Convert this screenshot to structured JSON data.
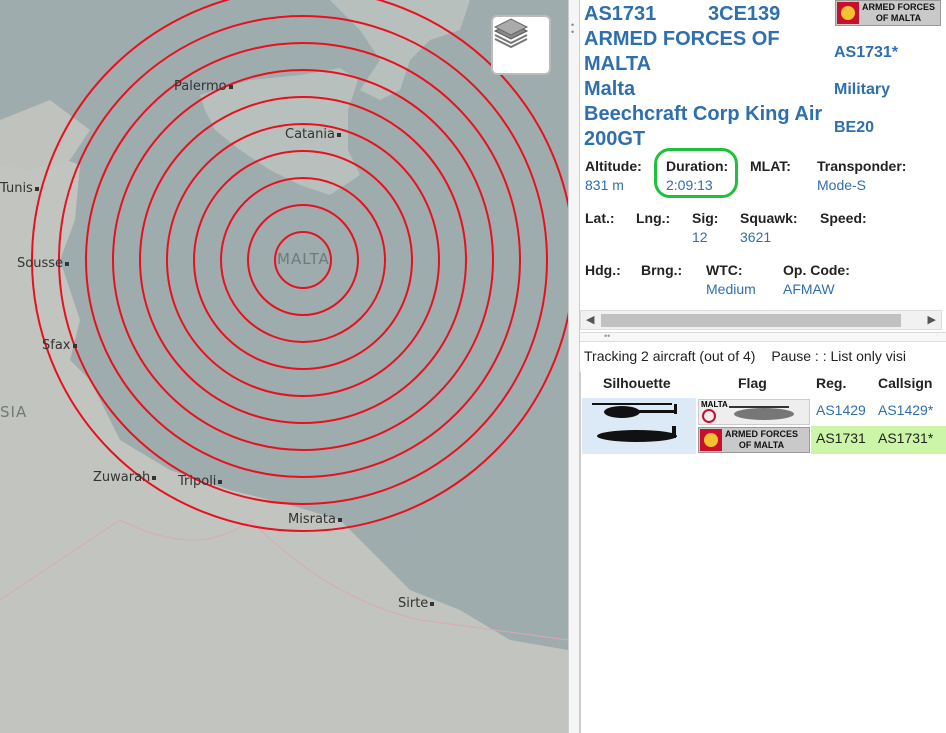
{
  "map": {
    "cities": [
      {
        "name": "Palermo"
      },
      {
        "name": "Catania"
      },
      {
        "name": "Tunis"
      },
      {
        "name": "Sousse"
      },
      {
        "name": "Sfax"
      },
      {
        "name": "Zuwarah"
      },
      {
        "name": "Tripoli"
      },
      {
        "name": "Misrata"
      },
      {
        "name": "Sirte"
      }
    ],
    "regions": {
      "malta": "MALTA",
      "libya": "SIA"
    },
    "ring_color": "#e8101e",
    "ring_count": 10,
    "layers_icon": "layers-icon"
  },
  "aircraft": {
    "reg": "AS1731",
    "hex": "3CE139",
    "operator": "ARMED FORCES OF MALTA",
    "country": "Malta",
    "type_line1": "Beechcraft Corp King Air",
    "type_line2": "200GT",
    "flag_text": "ARMED FORCES\nOF MALTA",
    "callsign": "AS1731*",
    "category": "Military",
    "type_code": "BE20"
  },
  "fields": {
    "altitude_label": "Altitude:",
    "altitude": "831 m",
    "duration_label": "Duration:",
    "duration": "2:09:13",
    "mlat_label": "MLAT:",
    "transponder_label": "Transponder:",
    "transponder": "Mode-S",
    "lat_label": "Lat.:",
    "lng_label": "Lng.:",
    "sig_label": "Sig:",
    "sig": "12",
    "squawk_label": "Squawk:",
    "squawk": "3621",
    "speed_label": "Speed:",
    "hdg_label": "Hdg.:",
    "brng_label": "Brng.:",
    "wtc_label": "WTC:",
    "wtc": "Medium",
    "opcode_label": "Op. Code:",
    "opcode": "AFMAW"
  },
  "list": {
    "tracking_text": "Tracking 2 aircraft (out of 4)",
    "pause_text": "Pause : : List only visi",
    "headers": {
      "silhouette": "Silhouette",
      "flag": "Flag",
      "reg": "Reg.",
      "callsign": "Callsign"
    },
    "rows": [
      {
        "reg": "AS1429",
        "callsign": "AS1429*",
        "flag_text": "MALTA",
        "highlight": false
      },
      {
        "reg": "AS1731",
        "callsign": "AS1731*",
        "flag_text": "ARMED FORCES\nOF MALTA",
        "highlight": true
      }
    ],
    "highlight_color": "#ccf5a8",
    "selected_silhouette_bg": "#dce9f7"
  },
  "annotation": {
    "duration_circle_color": "#1ec23a"
  }
}
